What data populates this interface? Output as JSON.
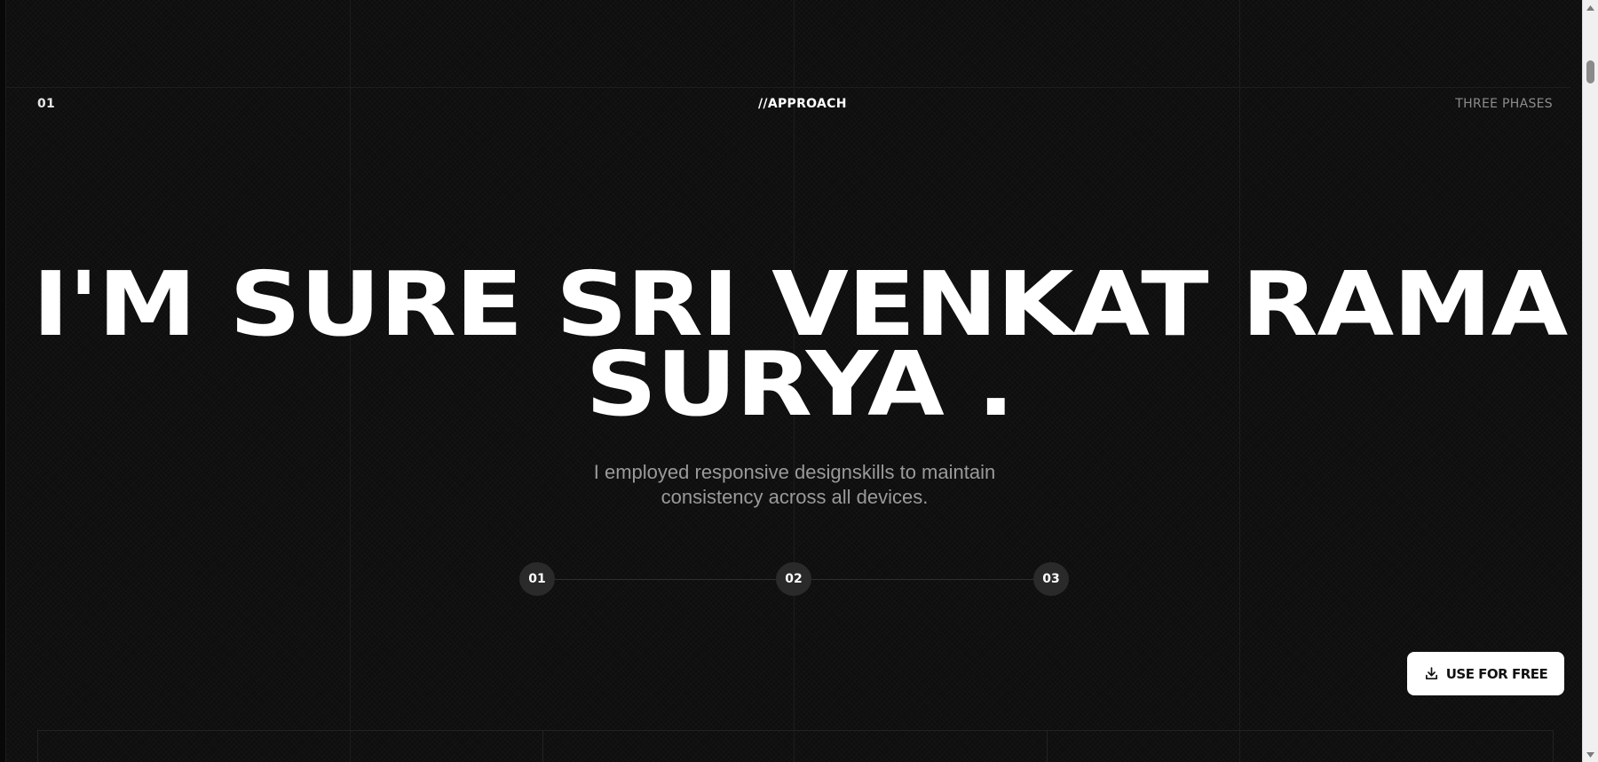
{
  "header": {
    "section_number": "01",
    "section_label": "//APPROACH",
    "section_meta": "THREE PHASES"
  },
  "hero": {
    "headline_line1": "I'M SURE SRI VENKAT RAMA",
    "headline_line2": "SURYA .",
    "subtext": "I employed responsive designskills to maintain consistency across all devices."
  },
  "phases": [
    {
      "label": "01"
    },
    {
      "label": "02"
    },
    {
      "label": "03"
    }
  ],
  "cta": {
    "label": "USE FOR FREE",
    "icon": "download-icon"
  },
  "colors": {
    "background": "#0e0e0e",
    "text": "#ffffff",
    "muted": "#9a9a9a",
    "button_bg": "#ffffff",
    "phase_dot": "#2a2a2a"
  }
}
